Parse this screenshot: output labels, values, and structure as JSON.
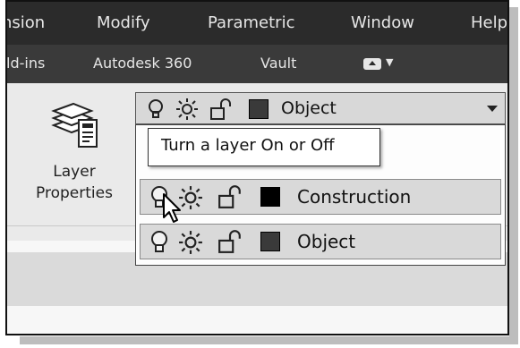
{
  "menu": {
    "items": [
      "nsion",
      "Modify",
      "Parametric",
      "Window",
      "Help"
    ]
  },
  "ribbon_tabs": {
    "items": [
      "ld-ins",
      "Autodesk 360",
      "Vault"
    ]
  },
  "layer_properties": {
    "label_line1": "Layer",
    "label_line2": "Properties"
  },
  "layer_combo": {
    "selected": "Object"
  },
  "tooltip": {
    "text": "Turn a layer On or Off"
  },
  "layer_list": [
    {
      "name": "Construction",
      "swatch": "#000000"
    },
    {
      "name": "Object",
      "swatch": "#3a3a3a"
    }
  ],
  "colors": {
    "menubar_bg": "#2b2b2b",
    "tabbar_bg": "#3a3a3a",
    "row_bg": "#d9d9d9"
  }
}
